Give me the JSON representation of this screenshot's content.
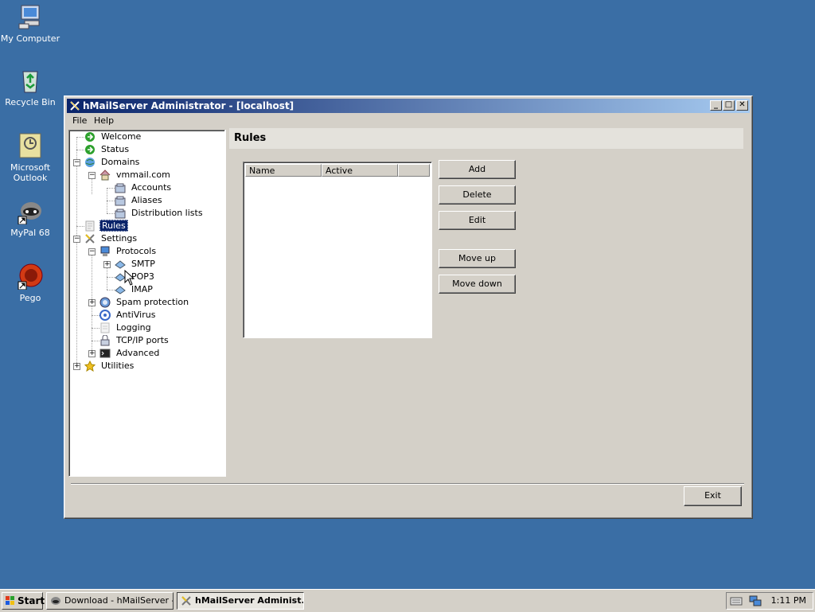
{
  "desktop": {
    "icons": [
      {
        "label": "My Computer",
        "icon": "my-computer-icon"
      },
      {
        "label": "Recycle Bin",
        "icon": "recycle-bin-icon"
      },
      {
        "label": "Microsoft Outlook",
        "icon": "outlook-icon"
      },
      {
        "label": "MyPal 68",
        "icon": "mypal-icon"
      },
      {
        "label": "Pego",
        "icon": "pego-icon"
      }
    ]
  },
  "window": {
    "title": "hMailServer Administrator - [localhost]",
    "controls": {
      "minimize": "_",
      "maximize": "□",
      "close": "✕"
    },
    "menu": [
      "File",
      "Help"
    ]
  },
  "tree": {
    "items": [
      {
        "label": "Welcome",
        "icon": "welcome-icon"
      },
      {
        "label": "Status",
        "icon": "status-icon"
      },
      {
        "label": "Domains",
        "icon": "domains-icon"
      },
      {
        "label": "vmmail.com",
        "icon": "domain-house-icon"
      },
      {
        "label": "Accounts",
        "icon": "accounts-icon"
      },
      {
        "label": "Aliases",
        "icon": "aliases-icon"
      },
      {
        "label": "Distribution lists",
        "icon": "distribution-lists-icon"
      },
      {
        "label": "Rules",
        "icon": "rules-icon",
        "selected": true
      },
      {
        "label": "Settings",
        "icon": "settings-icon"
      },
      {
        "label": "Protocols",
        "icon": "protocols-icon"
      },
      {
        "label": "SMTP",
        "icon": "smtp-icon"
      },
      {
        "label": "POP3",
        "icon": "pop3-icon"
      },
      {
        "label": "IMAP",
        "icon": "imap-icon"
      },
      {
        "label": "Spam protection",
        "icon": "spam-protection-icon"
      },
      {
        "label": "AntiVirus",
        "icon": "antivirus-icon"
      },
      {
        "label": "Logging",
        "icon": "logging-icon"
      },
      {
        "label": "TCP/IP ports",
        "icon": "tcpip-ports-icon"
      },
      {
        "label": "Advanced",
        "icon": "advanced-icon"
      },
      {
        "label": "Utilities",
        "icon": "utilities-icon"
      }
    ]
  },
  "panel": {
    "title": "Rules",
    "columns": [
      "Name",
      "Active"
    ],
    "buttons": {
      "add": "Add",
      "delete": "Delete",
      "edit": "Edit",
      "move_up": "Move up",
      "move_down": "Move down"
    },
    "exit": "Exit"
  },
  "taskbar": {
    "start": "Start",
    "tasks": [
      {
        "label": "Download - hMailServer -...",
        "icon": "browser-icon",
        "active": false
      },
      {
        "label": "hMailServer Administ...",
        "icon": "hmailserver-icon",
        "active": true
      }
    ],
    "tray_icons": [
      "keyboard-icon",
      "network-icon"
    ],
    "clock": "1:11 PM"
  },
  "colors": {
    "desktop": "#3a6ea5",
    "titlebar_start": "#0a246a",
    "titlebar_end": "#a6caf0",
    "face": "#d4d0c8",
    "selection": "#0a246a"
  }
}
